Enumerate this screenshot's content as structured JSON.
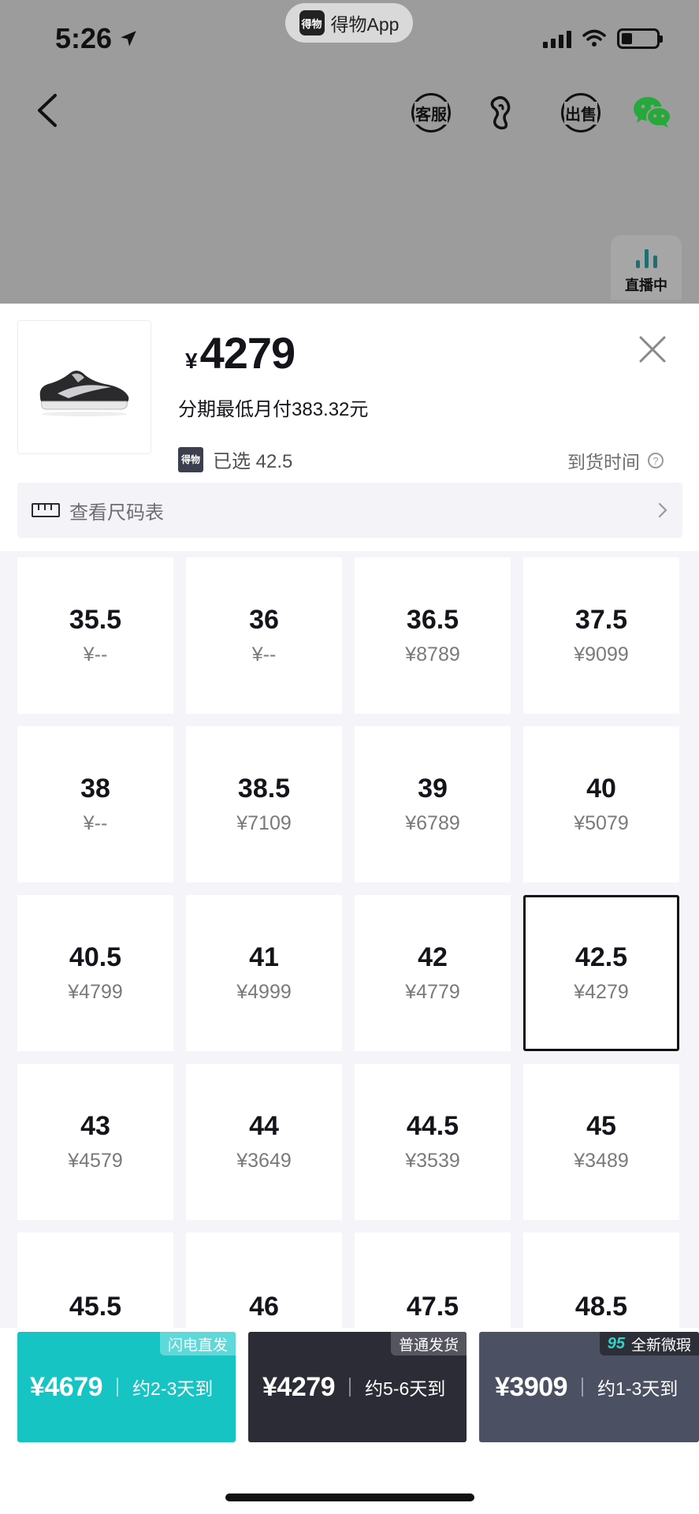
{
  "status_bar": {
    "time": "5:26",
    "app_pill": "得物App",
    "app_logo": "得物"
  },
  "top_nav": {
    "customer_service": "客服",
    "sell": "出售",
    "live": "直播中"
  },
  "product": {
    "price_symbol": "¥",
    "price": "4279",
    "installment": "分期最低月付383.32元",
    "selected_logo": "得物",
    "selected": "已选 42.5",
    "arrival_time": "到货时间",
    "size_chart": "查看尺码表"
  },
  "sizes": [
    {
      "size": "35.5",
      "price": "¥--"
    },
    {
      "size": "36",
      "price": "¥--"
    },
    {
      "size": "36.5",
      "price": "¥8789"
    },
    {
      "size": "37.5",
      "price": "¥9099"
    },
    {
      "size": "38",
      "price": "¥--"
    },
    {
      "size": "38.5",
      "price": "¥7109"
    },
    {
      "size": "39",
      "price": "¥6789"
    },
    {
      "size": "40",
      "price": "¥5079"
    },
    {
      "size": "40.5",
      "price": "¥4799"
    },
    {
      "size": "41",
      "price": "¥4999"
    },
    {
      "size": "42",
      "price": "¥4779"
    },
    {
      "size": "42.5",
      "price": "¥4279"
    },
    {
      "size": "43",
      "price": "¥4579"
    },
    {
      "size": "44",
      "price": "¥3649"
    },
    {
      "size": "44.5",
      "price": "¥3539"
    },
    {
      "size": "45",
      "price": "¥3489"
    },
    {
      "size": "45.5",
      "price": ""
    },
    {
      "size": "46",
      "price": ""
    },
    {
      "size": "47.5",
      "price": ""
    },
    {
      "size": "48.5",
      "price": ""
    }
  ],
  "selected_size": "42.5",
  "buy_options": [
    {
      "tag": "闪电直发",
      "price": "¥4679",
      "eta": "约2-3天到",
      "color": "#16c4c4"
    },
    {
      "tag": "普通发货",
      "price": "¥4279",
      "eta": "约5-6天到",
      "color": "#2b2c36"
    },
    {
      "tag": "全新微瑕",
      "badge": "95",
      "price": "¥3909",
      "eta": "约1-3天到",
      "color": "#4b5062"
    }
  ],
  "icons": {
    "back": "chevron-left-icon",
    "footprint": "footprint-icon",
    "wechat": "wechat-icon",
    "close": "close-icon",
    "ruler": "ruler-icon",
    "chevron": "chevron-right-icon",
    "help": "question-icon"
  }
}
